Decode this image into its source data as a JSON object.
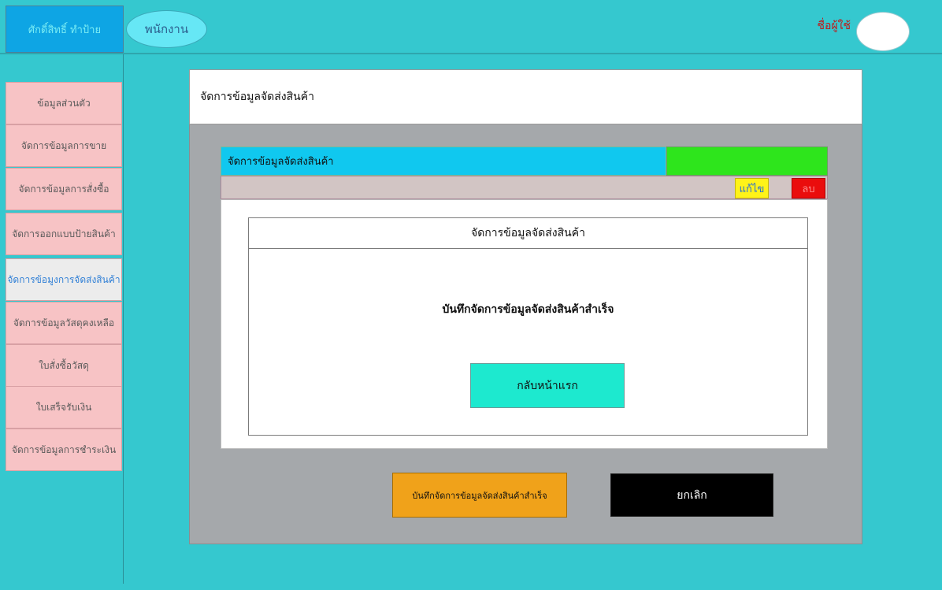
{
  "header": {
    "brand": "ศักดิ์สิทธิ์ ทำป้าย",
    "role": "พนักงาน",
    "username": "ชื่อผู้ใช้"
  },
  "sidebar": {
    "items": [
      {
        "label": "ข้อมูลส่วนตัว"
      },
      {
        "label": "จัดการข้อมูลการขาย"
      },
      {
        "label": "จัดการข้อมูลการสั่งซื้อ"
      },
      {
        "label": "จัดการออกแบบป้ายสินค้า"
      },
      {
        "label": "จัดการข้อมูงการจัดส่งสินค้า",
        "active": true
      },
      {
        "label": "จัดการข้อมูลวัสดุคงเหลือ"
      },
      {
        "label": "ใบสั่งซื้อวัสดุ"
      },
      {
        "label": "ใบเสร็จรับเงิน"
      },
      {
        "label": "จัดการข้อมูลการชำระเงิน"
      }
    ]
  },
  "main": {
    "page_title": "จัดการข้อมูลจัดส่งสินค้า",
    "form_header": "จัดการข้อมูลจัดส่งสินค้า",
    "edit_label": "แก้ไข",
    "delete_label": "ลบ",
    "dialog": {
      "title": "จัดการข้อมูลจัดส่งสินค้า",
      "message": "บันทึกจัดการข้อมูลจัดส่งสินค้าสำเร็จ",
      "home_button": "กลับหน้าแรก"
    },
    "save_button": "บันทึกจัดการข้อมูลจัดส่งสินค้าสำเร็จ",
    "cancel_button": "ยกเลิก"
  },
  "colors": {
    "background": "#35c8cf",
    "sidebar_item": "#f7c3c5",
    "form_header": "#10c8ef",
    "edit": "#fff318",
    "delete": "#ea0d0d",
    "save": "#f0a21a",
    "cancel": "#000000",
    "home": "#1de9cf"
  }
}
